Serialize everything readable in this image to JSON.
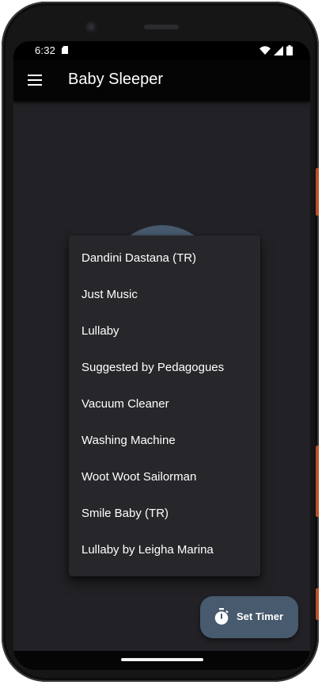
{
  "status_bar": {
    "time": "6:32",
    "icons": [
      "sd-card-icon",
      "wifi-icon",
      "signal-icon",
      "battery-icon"
    ]
  },
  "app_bar": {
    "title": "Baby Sleeper",
    "menu_icon": "hamburger-menu-icon"
  },
  "sound_menu": {
    "items": [
      "Dandini Dastana (TR)",
      "Just Music",
      "Lullaby",
      "Suggested by Pedagogues",
      "Vacuum Cleaner",
      "Washing Machine",
      "Woot Woot Sailorman",
      "Smile Baby (TR)",
      "Lullaby by Leigha Marina"
    ]
  },
  "fab": {
    "label": "Set Timer",
    "icon": "stopwatch-icon"
  },
  "colors": {
    "background": "#222226",
    "app_bar": "#050505",
    "menu_surface": "#27272b",
    "accent": "#475a6e",
    "text": "#ffffff"
  }
}
